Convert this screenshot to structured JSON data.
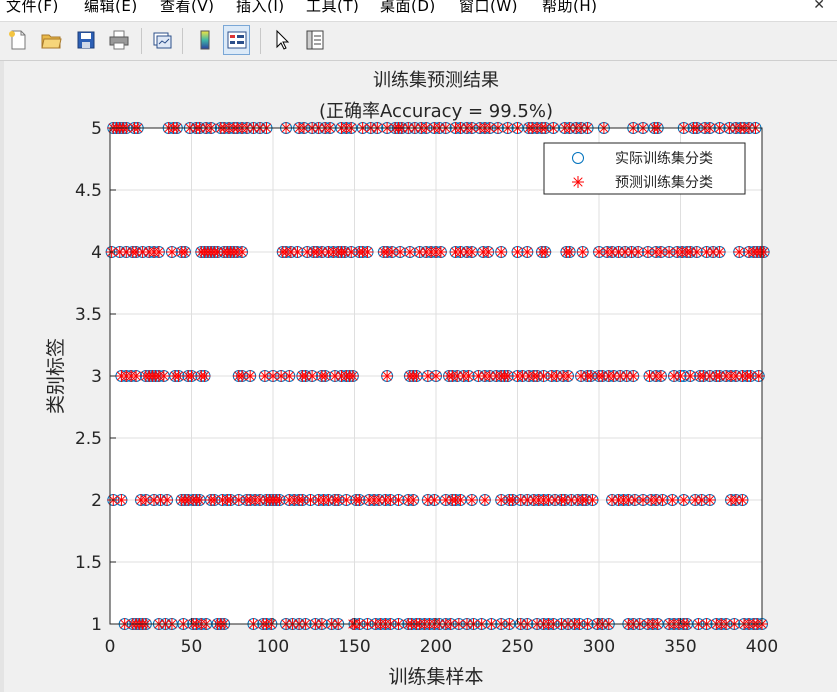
{
  "menu": {
    "items": [
      "文件(F)",
      "编辑(E)",
      "查看(V)",
      "插入(I)",
      "工具(T)",
      "桌面(D)",
      "窗口(W)",
      "帮助(H)"
    ],
    "close_glyph": "✕"
  },
  "toolbar": {
    "buttons": [
      {
        "name": "new-figure-icon"
      },
      {
        "name": "open-file-icon"
      },
      {
        "name": "save-icon"
      },
      {
        "name": "print-icon"
      },
      {
        "name": "link-plot-icon"
      },
      {
        "name": "insert-colorbar-icon"
      },
      {
        "name": "insert-legend-icon",
        "active": true
      },
      {
        "name": "edit-plot-arrow-icon"
      },
      {
        "name": "property-inspector-icon"
      }
    ]
  },
  "chart_data": {
    "type": "scatter",
    "title": "训练集预测结果",
    "subtitle": "(正确率Accuracy = 99.5%)",
    "xlabel": "训练集样本",
    "ylabel": "类别标签",
    "xlim": [
      0,
      400
    ],
    "ylim": [
      1,
      5
    ],
    "xticks": [
      "0",
      "50",
      "100",
      "150",
      "200",
      "250",
      "300",
      "350",
      "400"
    ],
    "yticks": [
      "1",
      "1.5",
      "2",
      "2.5",
      "3",
      "3.5",
      "4",
      "4.5",
      "5"
    ],
    "grid": true,
    "legend": {
      "placement": "top-right",
      "entries": [
        "实际训练集分类",
        "预测训练集分类"
      ]
    },
    "colors": {
      "actual": "#0072bd",
      "predicted": "#ff0000"
    },
    "series": [
      {
        "name": "实际训练集分类",
        "marker": "circle",
        "points": {
          "1": [
            9,
            14,
            16,
            18,
            20,
            22,
            30,
            34,
            38,
            45,
            51,
            53,
            56,
            59,
            66,
            68,
            70,
            88,
            94,
            96,
            99,
            108,
            112,
            116,
            120,
            126,
            130,
            136,
            140,
            150,
            153,
            158,
            163,
            166,
            169,
            172,
            177,
            183,
            185,
            188,
            190,
            193,
            196,
            199,
            202,
            206,
            209,
            214,
            219,
            223,
            228,
            234,
            240,
            245,
            252,
            256,
            262,
            266,
            269,
            272,
            277,
            281,
            285,
            288,
            293,
            299,
            302,
            306,
            318,
            321,
            325,
            330,
            333,
            336,
            343,
            346,
            349,
            352,
            354,
            361,
            366,
            372,
            375,
            378,
            383,
            389,
            392,
            395,
            397,
            400
          ],
          "2": [
            2,
            7,
            19,
            22,
            27,
            31,
            35,
            44,
            46,
            48,
            51,
            53,
            55,
            62,
            64,
            69,
            72,
            74,
            79,
            84,
            86,
            89,
            92,
            96,
            98,
            100,
            102,
            104,
            110,
            113,
            116,
            118,
            123,
            128,
            131,
            134,
            138,
            140,
            145,
            151,
            153,
            159,
            162,
            165,
            169,
            172,
            177,
            183,
            186,
            195,
            199,
            206,
            210,
            212,
            215,
            222,
            230,
            240,
            245,
            247,
            252,
            256,
            260,
            263,
            266,
            269,
            273,
            277,
            279,
            283,
            287,
            290,
            292,
            296,
            308,
            312,
            315,
            318,
            322,
            327,
            332,
            335,
            339,
            345,
            352,
            359,
            363,
            368,
            381,
            384,
            388
          ],
          "3": [
            7,
            10,
            13,
            16,
            22,
            24,
            26,
            28,
            30,
            33,
            40,
            42,
            48,
            50,
            56,
            58,
            79,
            81,
            86,
            95,
            100,
            105,
            110,
            118,
            120,
            124,
            130,
            132,
            138,
            142,
            145,
            147,
            149,
            170,
            184,
            186,
            188,
            195,
            200,
            208,
            210,
            213,
            217,
            220,
            226,
            230,
            233,
            237,
            240,
            242,
            244,
            250,
            253,
            257,
            260,
            262,
            266,
            271,
            274,
            278,
            281,
            289,
            293,
            295,
            300,
            302,
            306,
            309,
            313,
            317,
            321,
            331,
            335,
            338,
            346,
            350,
            352,
            356,
            362,
            364,
            368,
            372,
            374,
            378,
            381,
            384,
            388,
            391,
            393,
            398
          ],
          "4": [
            1,
            6,
            10,
            14,
            16,
            20,
            24,
            27,
            30,
            38,
            44,
            46,
            56,
            58,
            60,
            62,
            64,
            66,
            70,
            72,
            74,
            76,
            78,
            81,
            106,
            108,
            111,
            115,
            121,
            125,
            127,
            130,
            134,
            137,
            140,
            142,
            144,
            148,
            153,
            155,
            158,
            168,
            170,
            173,
            178,
            184,
            190,
            194,
            197,
            200,
            203,
            212,
            215,
            219,
            222,
            229,
            232,
            240,
            250,
            256,
            265,
            267,
            280,
            282,
            290,
            300,
            305,
            308,
            312,
            316,
            320,
            324,
            330,
            335,
            338,
            343,
            348,
            351,
            354,
            356,
            360,
            366,
            370,
            374,
            386,
            392,
            395,
            397,
            399,
            401
          ],
          "5": [
            2,
            4,
            6,
            8,
            10,
            15,
            17,
            36,
            39,
            41,
            49,
            53,
            55,
            59,
            62,
            68,
            70,
            73,
            76,
            78,
            81,
            84,
            88,
            92,
            96,
            108,
            116,
            119,
            124,
            128,
            132,
            135,
            142,
            145,
            148,
            155,
            160,
            164,
            170,
            175,
            177,
            179,
            183,
            187,
            191,
            194,
            199,
            202,
            206,
            212,
            215,
            219,
            222,
            227,
            230,
            233,
            238,
            244,
            250,
            257,
            259,
            262,
            265,
            267,
            272,
            279,
            282,
            286,
            289,
            293,
            303,
            321,
            327,
            334,
            336,
            352,
            358,
            360,
            365,
            368,
            374,
            380,
            384,
            387,
            389,
            392,
            396
          ]
        }
      },
      {
        "name": "预测训练集分类",
        "marker": "asterisk",
        "note_misclassified": [
          [
            149,
            2,
            1
          ],
          [
            353,
            3,
            3
          ]
        ],
        "points": {
          "1": [
            9,
            14,
            16,
            18,
            20,
            22,
            30,
            34,
            38,
            45,
            51,
            53,
            56,
            59,
            66,
            68,
            70,
            88,
            94,
            96,
            99,
            108,
            112,
            116,
            120,
            126,
            130,
            136,
            140,
            149,
            150,
            153,
            158,
            163,
            166,
            169,
            172,
            177,
            183,
            185,
            188,
            190,
            193,
            196,
            199,
            202,
            206,
            209,
            214,
            219,
            223,
            228,
            234,
            240,
            245,
            252,
            256,
            262,
            266,
            269,
            272,
            277,
            281,
            285,
            288,
            293,
            299,
            302,
            306,
            318,
            321,
            325,
            330,
            333,
            336,
            343,
            346,
            349,
            352,
            354,
            361,
            366,
            372,
            375,
            378,
            383,
            389,
            392,
            395,
            397,
            400
          ],
          "2": [
            2,
            7,
            19,
            22,
            27,
            31,
            35,
            44,
            46,
            48,
            51,
            53,
            55,
            62,
            64,
            69,
            72,
            74,
            79,
            84,
            86,
            89,
            92,
            96,
            98,
            100,
            102,
            104,
            110,
            113,
            116,
            118,
            123,
            128,
            131,
            134,
            138,
            140,
            145,
            151,
            153,
            159,
            162,
            165,
            169,
            172,
            177,
            183,
            186,
            195,
            199,
            206,
            210,
            212,
            215,
            222,
            230,
            240,
            245,
            247,
            252,
            256,
            260,
            263,
            266,
            269,
            273,
            277,
            279,
            283,
            287,
            290,
            292,
            296,
            308,
            312,
            315,
            318,
            322,
            327,
            332,
            335,
            339,
            345,
            352,
            359,
            363,
            368,
            381,
            384,
            388
          ],
          "3": [
            7,
            10,
            13,
            16,
            22,
            24,
            26,
            28,
            30,
            33,
            40,
            42,
            48,
            50,
            56,
            58,
            79,
            81,
            86,
            95,
            100,
            105,
            110,
            118,
            120,
            124,
            130,
            132,
            138,
            142,
            145,
            147,
            149,
            170,
            184,
            186,
            188,
            195,
            200,
            208,
            210,
            213,
            217,
            220,
            226,
            230,
            233,
            237,
            240,
            242,
            244,
            250,
            253,
            257,
            260,
            262,
            266,
            271,
            274,
            278,
            281,
            289,
            293,
            295,
            300,
            302,
            306,
            309,
            313,
            317,
            321,
            331,
            335,
            338,
            346,
            350,
            356,
            362,
            364,
            368,
            372,
            374,
            378,
            381,
            384,
            388,
            391,
            393,
            398
          ],
          "4": [
            1,
            6,
            10,
            14,
            16,
            20,
            24,
            27,
            30,
            38,
            44,
            46,
            56,
            58,
            60,
            62,
            64,
            66,
            70,
            72,
            74,
            76,
            78,
            81,
            106,
            108,
            111,
            115,
            121,
            125,
            127,
            130,
            134,
            137,
            140,
            142,
            144,
            148,
            153,
            155,
            158,
            168,
            170,
            173,
            178,
            184,
            190,
            194,
            197,
            200,
            203,
            212,
            215,
            219,
            222,
            229,
            232,
            240,
            250,
            256,
            265,
            267,
            280,
            282,
            290,
            300,
            305,
            308,
            312,
            316,
            320,
            324,
            330,
            335,
            338,
            343,
            348,
            351,
            354,
            356,
            360,
            366,
            370,
            374,
            386,
            392,
            395,
            397,
            399,
            401
          ],
          "5": [
            2,
            4,
            6,
            8,
            10,
            15,
            17,
            36,
            39,
            41,
            49,
            53,
            55,
            59,
            62,
            68,
            70,
            73,
            76,
            78,
            81,
            84,
            88,
            92,
            96,
            108,
            116,
            119,
            124,
            128,
            132,
            135,
            142,
            145,
            148,
            155,
            160,
            164,
            170,
            175,
            177,
            179,
            183,
            187,
            191,
            194,
            199,
            202,
            206,
            212,
            215,
            219,
            222,
            227,
            230,
            233,
            238,
            244,
            250,
            257,
            259,
            262,
            265,
            267,
            272,
            279,
            282,
            286,
            289,
            293,
            303,
            321,
            327,
            334,
            336,
            352,
            358,
            360,
            365,
            368,
            374,
            380,
            384,
            387,
            389,
            392,
            396
          ]
        }
      }
    ]
  }
}
